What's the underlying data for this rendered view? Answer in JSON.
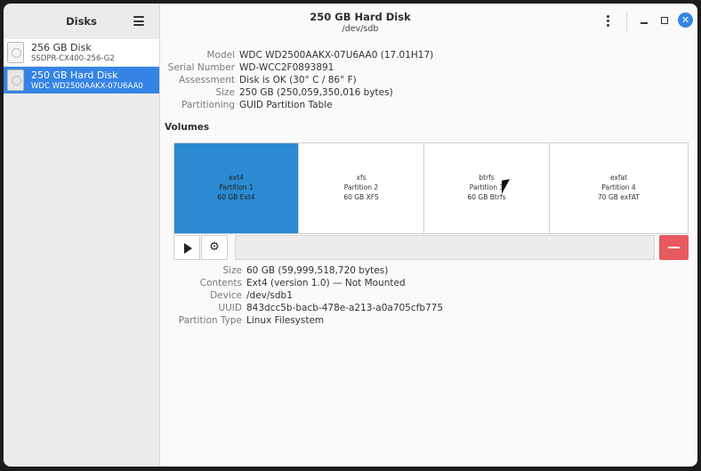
{
  "sidebar": {
    "title": "Disks",
    "disks": [
      {
        "name": "256 GB Disk",
        "model": "SSDPR-CX400-256-G2"
      },
      {
        "name": "250 GB Hard Disk",
        "model": "WDC WD2500AAKX-07U6AA0"
      }
    ]
  },
  "header": {
    "title": "250 GB Hard Disk",
    "subtitle": "/dev/sdb"
  },
  "disk_info": [
    {
      "label": "Model",
      "value": "WDC WD2500AAKX-07U6AA0 (17.01H17)"
    },
    {
      "label": "Serial Number",
      "value": "WD-WCC2F0893891"
    },
    {
      "label": "Assessment",
      "value": "Disk is OK (30° C / 86° F)"
    },
    {
      "label": "Size",
      "value": "250 GB (250,059,350,016 bytes)"
    },
    {
      "label": "Partitioning",
      "value": "GUID Partition Table"
    }
  ],
  "volumes": {
    "title": "Volumes",
    "partitions": [
      {
        "fs": "ext4",
        "name": "Partition 1",
        "desc": "60 GB Ext4"
      },
      {
        "fs": "xfs",
        "name": "Partition 2",
        "desc": "60 GB XFS"
      },
      {
        "fs": "btrfs",
        "name": "Partition 3",
        "desc": "60 GB Btrfs"
      },
      {
        "fs": "exfat",
        "name": "Partition 4",
        "desc": "70 GB exFAT"
      }
    ]
  },
  "partition_info": [
    {
      "label": "Size",
      "value": "60 GB (59,999,518,720 bytes)"
    },
    {
      "label": "Contents",
      "value": "Ext4 (version 1.0) — Not Mounted"
    },
    {
      "label": "Device",
      "value": "/dev/sdb1"
    },
    {
      "label": "UUID",
      "value": "843dcc5b-bacb-478e-a213-a0a705cfb775"
    },
    {
      "label": "Partition Type",
      "value": "Linux Filesystem"
    }
  ],
  "colors": {
    "accent": "#3584e4",
    "selected_partition": "#2b8ad1",
    "delete": "#e75a5f"
  },
  "icons": [
    "hamburger-menu-icon",
    "disk-icon",
    "kebab-menu-icon",
    "minimize-icon",
    "maximize-icon",
    "close-icon",
    "play-icon",
    "gear-icon",
    "minus-icon",
    "mouse-cursor-icon"
  ]
}
